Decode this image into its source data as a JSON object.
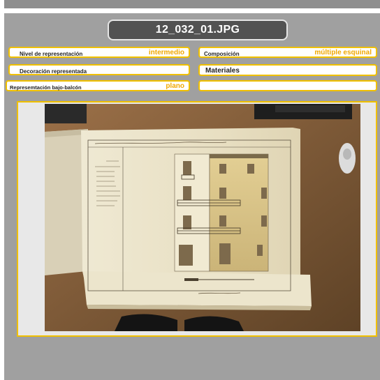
{
  "title": "12_032_01.JPG",
  "fields": {
    "nivel": {
      "label": "Nivel de representación",
      "value": "intermedio"
    },
    "composicion": {
      "label": "Composición",
      "value": "múltiple esquinal"
    },
    "decoracion": {
      "label": "Decoración representada",
      "value": ""
    },
    "materiales": {
      "label": "Materiales",
      "value": ""
    },
    "bajo_balcon": {
      "label": "Represemtación bajo-balcón",
      "value": "plano"
    },
    "empty": {
      "label": "",
      "value": ""
    }
  },
  "photo": {
    "icon": "architectural-drawing-photo"
  }
}
